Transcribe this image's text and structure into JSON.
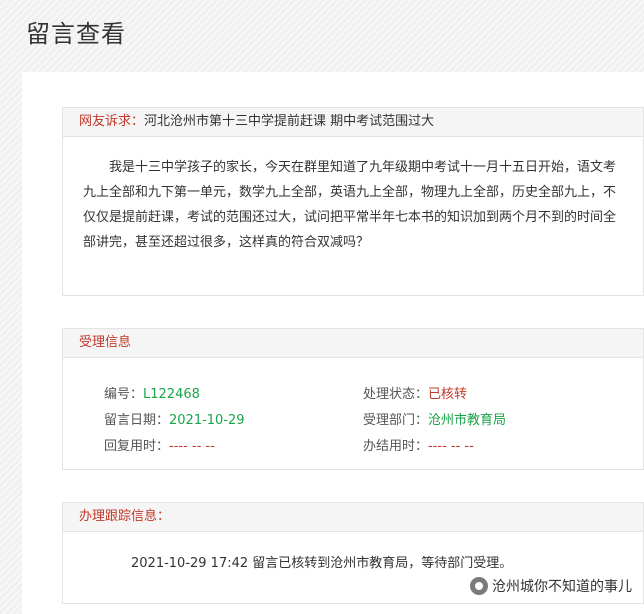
{
  "page": {
    "title": "留言查看"
  },
  "complaint": {
    "label": "网友诉求：",
    "title": "河北沧州市第十三中学提前赶课 期中考试范围过大",
    "lines": [
      "我是十三中学孩子的家长，今天在群里知道了九年级期中考试十一月十五日开始，语文考九",
      "上全部和九下第一单元，数学九上全部，英语九上全部，物理九上全部，历史全部九上，不仅仅",
      "是提前赶课，考试的范围还过大，试问把平常半年七本书的知识加到两个月不到的时间全部讲",
      "完，甚至还超过很多，这样真的符合双减吗？"
    ]
  },
  "acceptance": {
    "heading": "受理信息",
    "number_label": "编号：",
    "number_value": "L122468",
    "status_label": "处理状态：",
    "status_value": "已核转",
    "date_label": "留言日期：",
    "date_value": "2021-10-29",
    "dept_label": "受理部门：",
    "dept_value": "沧州市教育局",
    "reply_label": "回复用时：",
    "reply_value": "---- -- --",
    "finish_label": "办结用时：",
    "finish_value": "---- -- --"
  },
  "tracking": {
    "heading": "办理跟踪信息：",
    "entry": "2021-10-29 17:42 留言已核转到沧州市教育局，等待部门受理。"
  },
  "watermark": {
    "text": "沧州城你不知道的事儿",
    "icon": "wechat-icon"
  }
}
